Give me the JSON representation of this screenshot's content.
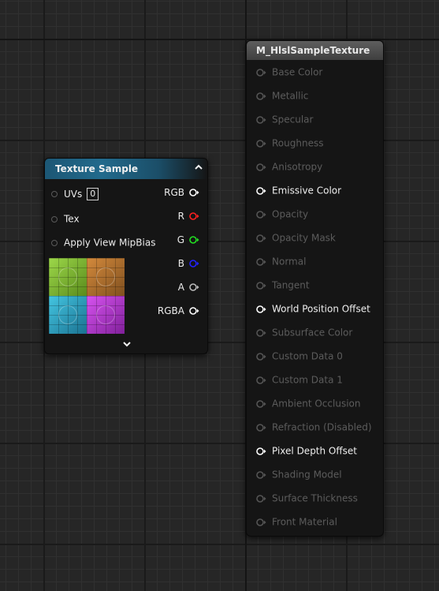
{
  "texture_sample": {
    "title": "Texture Sample",
    "inputs": [
      {
        "label": "UVs",
        "value": "0"
      },
      {
        "label": "Tex"
      },
      {
        "label": "Apply View MipBias"
      }
    ],
    "outputs": [
      {
        "label": "RGB",
        "color": "#ffffff"
      },
      {
        "label": "R",
        "color": "#ff2020"
      },
      {
        "label": "G",
        "color": "#22e022"
      },
      {
        "label": "B",
        "color": "#2222ff"
      },
      {
        "label": "A",
        "color": "#bbbbbb"
      },
      {
        "label": "RGBA",
        "color": "#ffffff"
      }
    ]
  },
  "material": {
    "title": "M_HlslSampleTexture",
    "inputs": [
      {
        "label": "Base Color",
        "active": false
      },
      {
        "label": "Metallic",
        "active": false
      },
      {
        "label": "Specular",
        "active": false
      },
      {
        "label": "Roughness",
        "active": false
      },
      {
        "label": "Anisotropy",
        "active": false
      },
      {
        "label": "Emissive Color",
        "active": true
      },
      {
        "label": "Opacity",
        "active": false
      },
      {
        "label": "Opacity Mask",
        "active": false
      },
      {
        "label": "Normal",
        "active": false
      },
      {
        "label": "Tangent",
        "active": false
      },
      {
        "label": "World Position Offset",
        "active": true
      },
      {
        "label": "Subsurface Color",
        "active": false
      },
      {
        "label": "Custom Data 0",
        "active": false
      },
      {
        "label": "Custom Data 1",
        "active": false
      },
      {
        "label": "Ambient Occlusion",
        "active": false
      },
      {
        "label": "Refraction (Disabled)",
        "active": false
      },
      {
        "label": "Pixel Depth Offset",
        "active": true
      },
      {
        "label": "Shading Model",
        "active": false
      },
      {
        "label": "Surface Thickness",
        "active": false
      },
      {
        "label": "Front Material",
        "active": false
      }
    ]
  }
}
